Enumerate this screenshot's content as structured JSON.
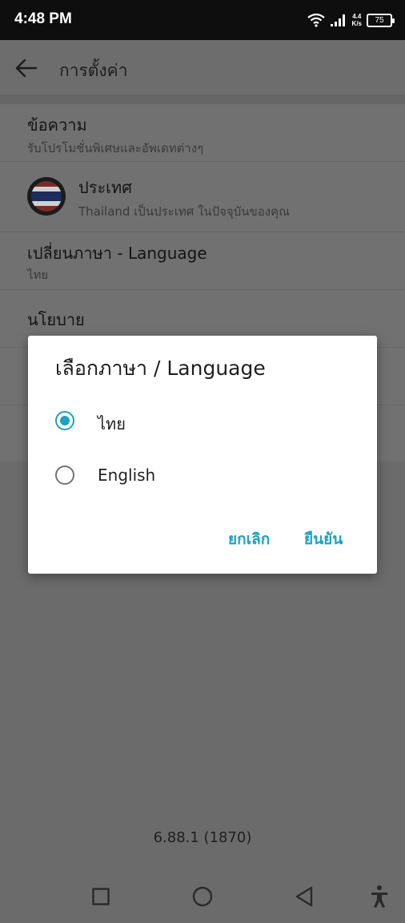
{
  "status_bar": {
    "time": "4:48 PM",
    "net_speed_value": "4.4",
    "net_speed_unit": "K/s",
    "battery": "75",
    "icons": [
      "wifi-icon",
      "signal-icon",
      "battery-icon"
    ]
  },
  "toolbar": {
    "title": "การตั้งค่า",
    "back_icon": "back-arrow-icon"
  },
  "settings": {
    "messages": {
      "title": "ข้อความ",
      "subtitle": "รับโปรโมชั่นพิเศษและอัพเดทต่างๆ"
    },
    "country": {
      "title": "ประเทศ",
      "subtitle": "Thailand เป็นประเทศ ในปัจจุบันของคุณ",
      "flag_icon": "thailand-flag-icon"
    },
    "language": {
      "title": "เปลี่ยนภาษา - Language",
      "subtitle": "ไทย"
    },
    "policy": {
      "title": "นโยบาย"
    }
  },
  "version": "6.88.1 (1870)",
  "dialog": {
    "title": "เลือกภาษา / Language",
    "options": [
      {
        "label": "ไทย",
        "selected": true
      },
      {
        "label": "English",
        "selected": false
      }
    ],
    "cancel_label": "ยกเลิก",
    "confirm_label": "ยืนยัน"
  },
  "colors": {
    "accent": "#1fa1bf",
    "scrim_background": "#6b6b6b",
    "status_bar": "#0e0e0e"
  },
  "nav_bar": {
    "icons": [
      "recents-square-icon",
      "home-circle-icon",
      "back-triangle-icon",
      "accessibility-icon"
    ]
  }
}
